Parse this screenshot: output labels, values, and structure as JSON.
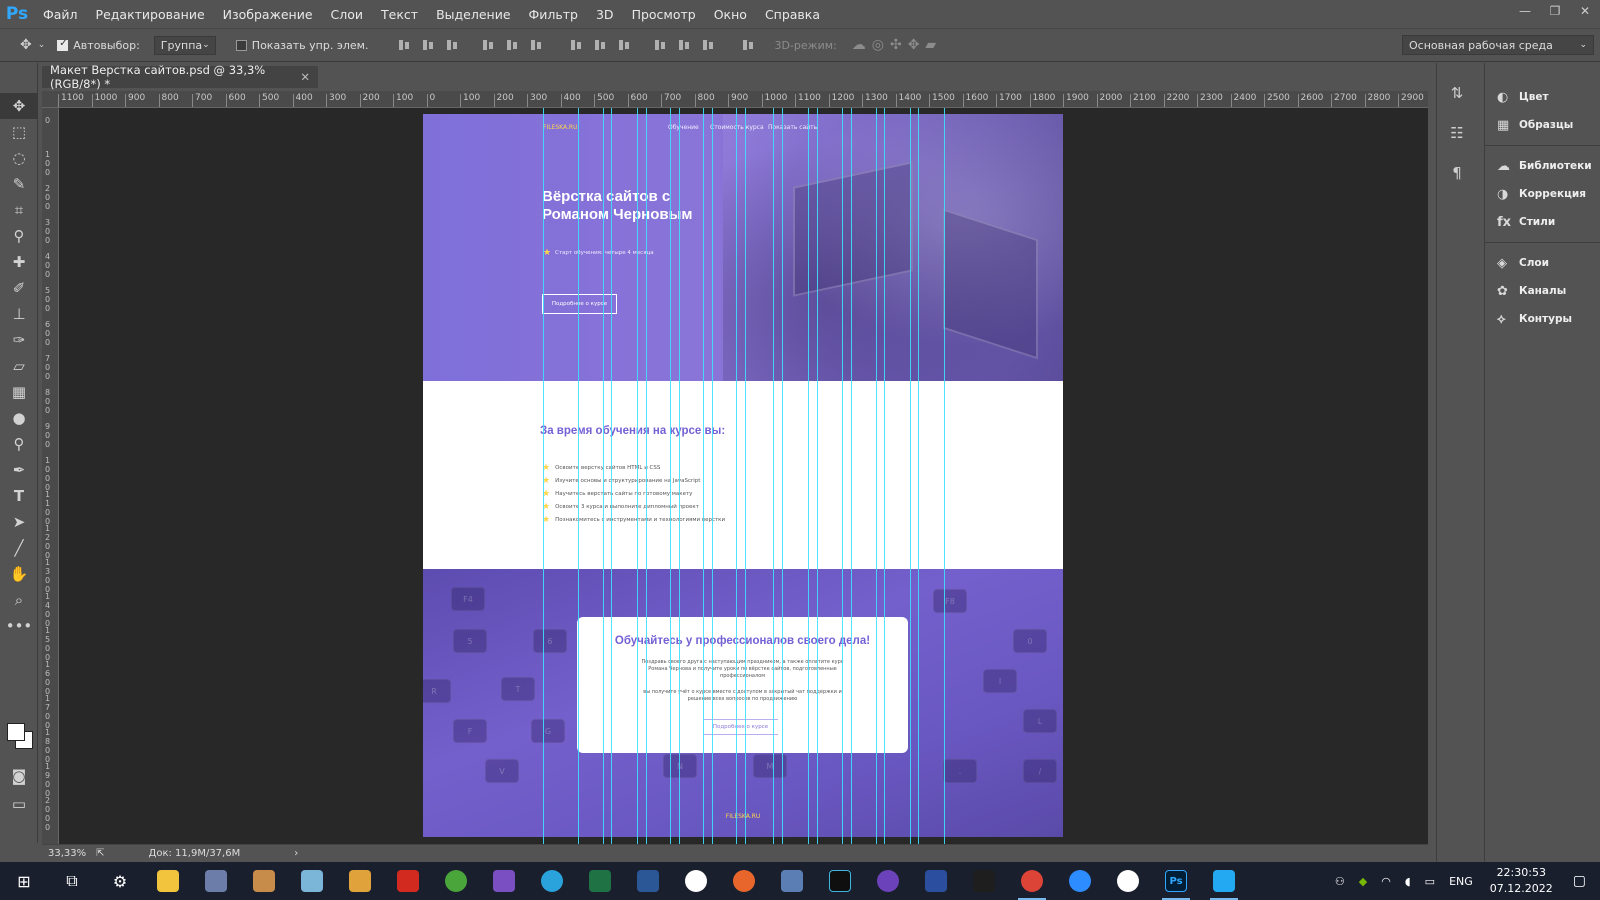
{
  "menubar": {
    "logo": "Ps",
    "items": [
      "Файл",
      "Редактирование",
      "Изображение",
      "Слои",
      "Текст",
      "Выделение",
      "Фильтр",
      "3D",
      "Просмотр",
      "Окно",
      "Справка"
    ]
  },
  "options": {
    "autoselect_label": "Автовыбор:",
    "autoselect_value": "Группа",
    "show_transform_label": "Показать упр. элем.",
    "mode_3d_label": "3D-режим:",
    "workspace_value": "Основная рабочая среда"
  },
  "document": {
    "tab_title": "Макет Верстка сайтов.psd @ 33,3% (RGB/8*) *",
    "zoom": "33,33%",
    "doc_info": "Док: 11,9M/37,6M"
  },
  "ruler": {
    "h_labels": [
      "1100",
      "1000",
      "900",
      "800",
      "700",
      "600",
      "500",
      "400",
      "300",
      "200",
      "100",
      "0",
      "100",
      "200",
      "300",
      "400",
      "500",
      "600",
      "700",
      "800",
      "900",
      "1000",
      "1100",
      "1200",
      "1300",
      "1400",
      "1500",
      "1600",
      "1700",
      "1800",
      "1900",
      "2000",
      "2100",
      "2200",
      "2300",
      "2400",
      "2500",
      "2600",
      "2700",
      "2800",
      "2900"
    ],
    "v_labels": [
      "0",
      "100",
      "200",
      "300",
      "400",
      "500",
      "600",
      "700",
      "800",
      "900",
      "1000",
      "1100",
      "1200",
      "1300",
      "1400",
      "1500",
      "1600",
      "1700",
      "1800",
      "1900",
      "2000"
    ]
  },
  "mockup": {
    "hero": {
      "logo": "FILESKA.RU",
      "nav": [
        "Обучение",
        "Стоимость курса",
        "Показать сайты"
      ],
      "title_line1": "Вёрстка сайтов с",
      "title_line2": "Романом Черновым",
      "subtitle": "Старт обучения: четыре 4 месяца",
      "button": "Подробнее о курсе"
    },
    "learn": {
      "title": "За время обучения на курсе вы:",
      "items": [
        "Освоите верстку сайтов HTML и CSS",
        "Изучите основы и структурирование на JavaScript",
        "Научитесь верстать сайты по готовому макету",
        "Освоите 3 курса и выполните дипломный проект",
        "Познакомитесь с инструментами и технологиями верстки"
      ]
    },
    "promo": {
      "title": "Обучайтесь у профессионалов своего дела!",
      "text1": "Поздравь своего друга с наступающим праздником, а также оплатите курс Романа Чернова и получите уроки по вёрстке сайтов, подготовленные профессионалом",
      "text2": "вы получите учёт о курсе вместе с доступом в закрытый чат поддержки и решение всех вопросов по продвижению",
      "button": "Подробнее о курсе",
      "footer_logo": "FILESKA.RU"
    }
  },
  "panels": {
    "items": [
      {
        "label": "Цвет",
        "icon": "color-icon"
      },
      {
        "label": "Образцы",
        "icon": "swatches-icon"
      },
      {
        "label": "Библиотеки",
        "icon": "libraries-icon"
      },
      {
        "label": "Коррекция",
        "icon": "adjustments-icon"
      },
      {
        "label": "Стили",
        "icon": "styles-icon"
      },
      {
        "label": "Слои",
        "icon": "layers-icon"
      },
      {
        "label": "Каналы",
        "icon": "channels-icon"
      },
      {
        "label": "Контуры",
        "icon": "paths-icon"
      }
    ]
  },
  "taskbar": {
    "lang": "ENG",
    "time": "22:30:53",
    "date": "07.12.2022"
  },
  "colors": {
    "accent": "#7560d4",
    "guide": "#3ee0ff",
    "ps_blue": "#31a8ff"
  }
}
